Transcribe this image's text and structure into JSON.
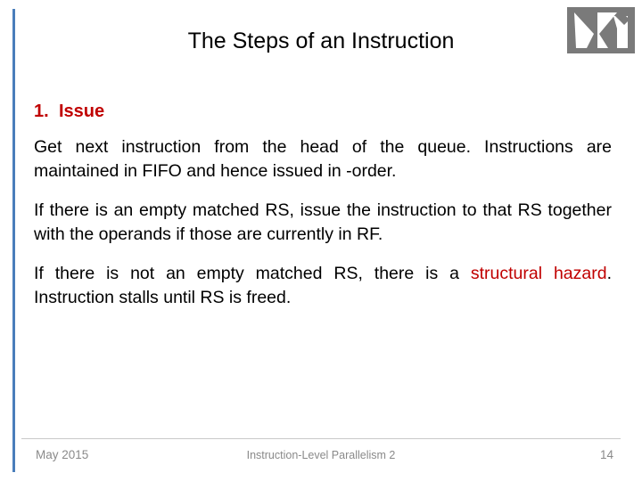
{
  "slide": {
    "title": "The Steps of an Instruction",
    "list": [
      {
        "number": "1.",
        "label": "Issue"
      }
    ],
    "paragraphs": [
      {
        "id": "p1",
        "text": "Get next instruction from the head of the queue. Instructions are maintained in FIFO and hence issued in -order."
      },
      {
        "id": "p2",
        "text": "If there is an empty matched RS, issue the instruction to that RS together with the operands if those are currently in RF."
      }
    ],
    "paragraph3": {
      "lead": "If there is not an empty matched RS, there is a ",
      "highlight": "structural hazard",
      "tail": ". Instruction stalls until RS is freed."
    },
    "footer": {
      "date": "May 2015",
      "center": "Instruction-Level Parallelism 2",
      "page": "14"
    },
    "colors": {
      "accent_bar": "#4a7ebb",
      "heading_red": "#c00000",
      "logo_bg": "#7a7a7a",
      "footer_text": "#8a8a8a"
    }
  }
}
